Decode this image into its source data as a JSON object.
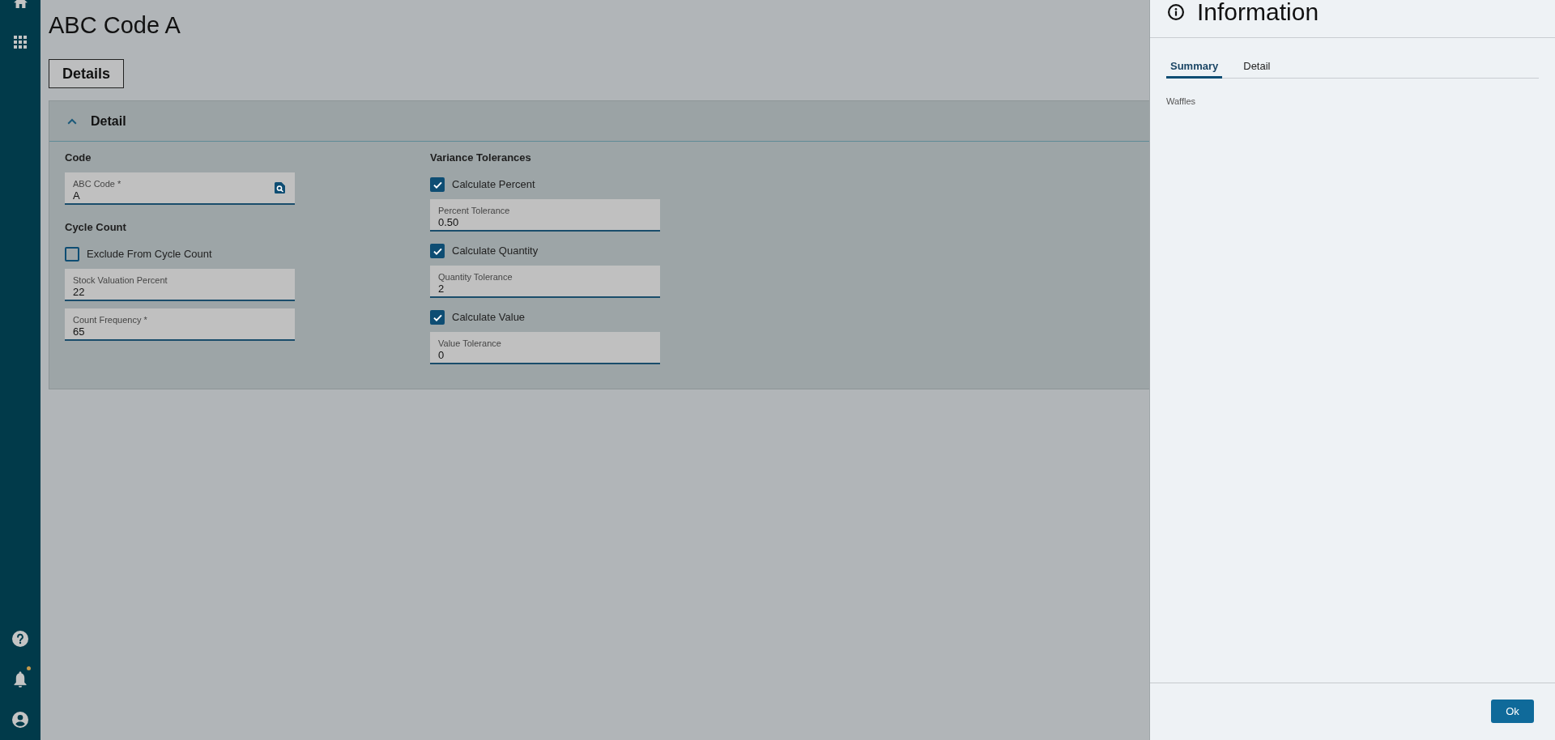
{
  "sidebar": {
    "bell": {
      "unread": true
    }
  },
  "page": {
    "title": "ABC Code A",
    "view_button": "Details"
  },
  "card": {
    "title": "Detail",
    "expanded": true,
    "columns": [
      {
        "groups": [
          {
            "heading": "Code",
            "items": [
              {
                "kind": "field",
                "label": "ABC Code *",
                "value": "A",
                "lookup": true
              }
            ]
          },
          {
            "heading": "Cycle Count",
            "items": [
              {
                "kind": "checkbox",
                "label": "Exclude From Cycle Count",
                "checked": false
              },
              {
                "kind": "field",
                "label": "Stock Valuation Percent",
                "value": "22",
                "lookup": false
              },
              {
                "kind": "field",
                "label": "Count Frequency *",
                "value": "65",
                "lookup": false
              }
            ]
          }
        ]
      },
      {
        "groups": [
          {
            "heading": "Variance Tolerances",
            "items": [
              {
                "kind": "checkbox",
                "label": "Calculate Percent",
                "checked": true
              },
              {
                "kind": "field",
                "label": "Percent Tolerance",
                "value": "0.50",
                "lookup": false
              },
              {
                "kind": "checkbox",
                "label": "Calculate Quantity",
                "checked": true
              },
              {
                "kind": "field",
                "label": "Quantity Tolerance",
                "value": "2",
                "lookup": false
              },
              {
                "kind": "checkbox",
                "label": "Calculate Value",
                "checked": true
              },
              {
                "kind": "field",
                "label": "Value Tolerance",
                "value": "0",
                "lookup": false
              }
            ]
          }
        ]
      }
    ]
  },
  "panel": {
    "title": "Information",
    "tabs": [
      {
        "label": "Summary",
        "selected": true
      },
      {
        "label": "Detail",
        "selected": false
      }
    ],
    "content": "Waffles",
    "buttons": [
      "Ok"
    ]
  }
}
